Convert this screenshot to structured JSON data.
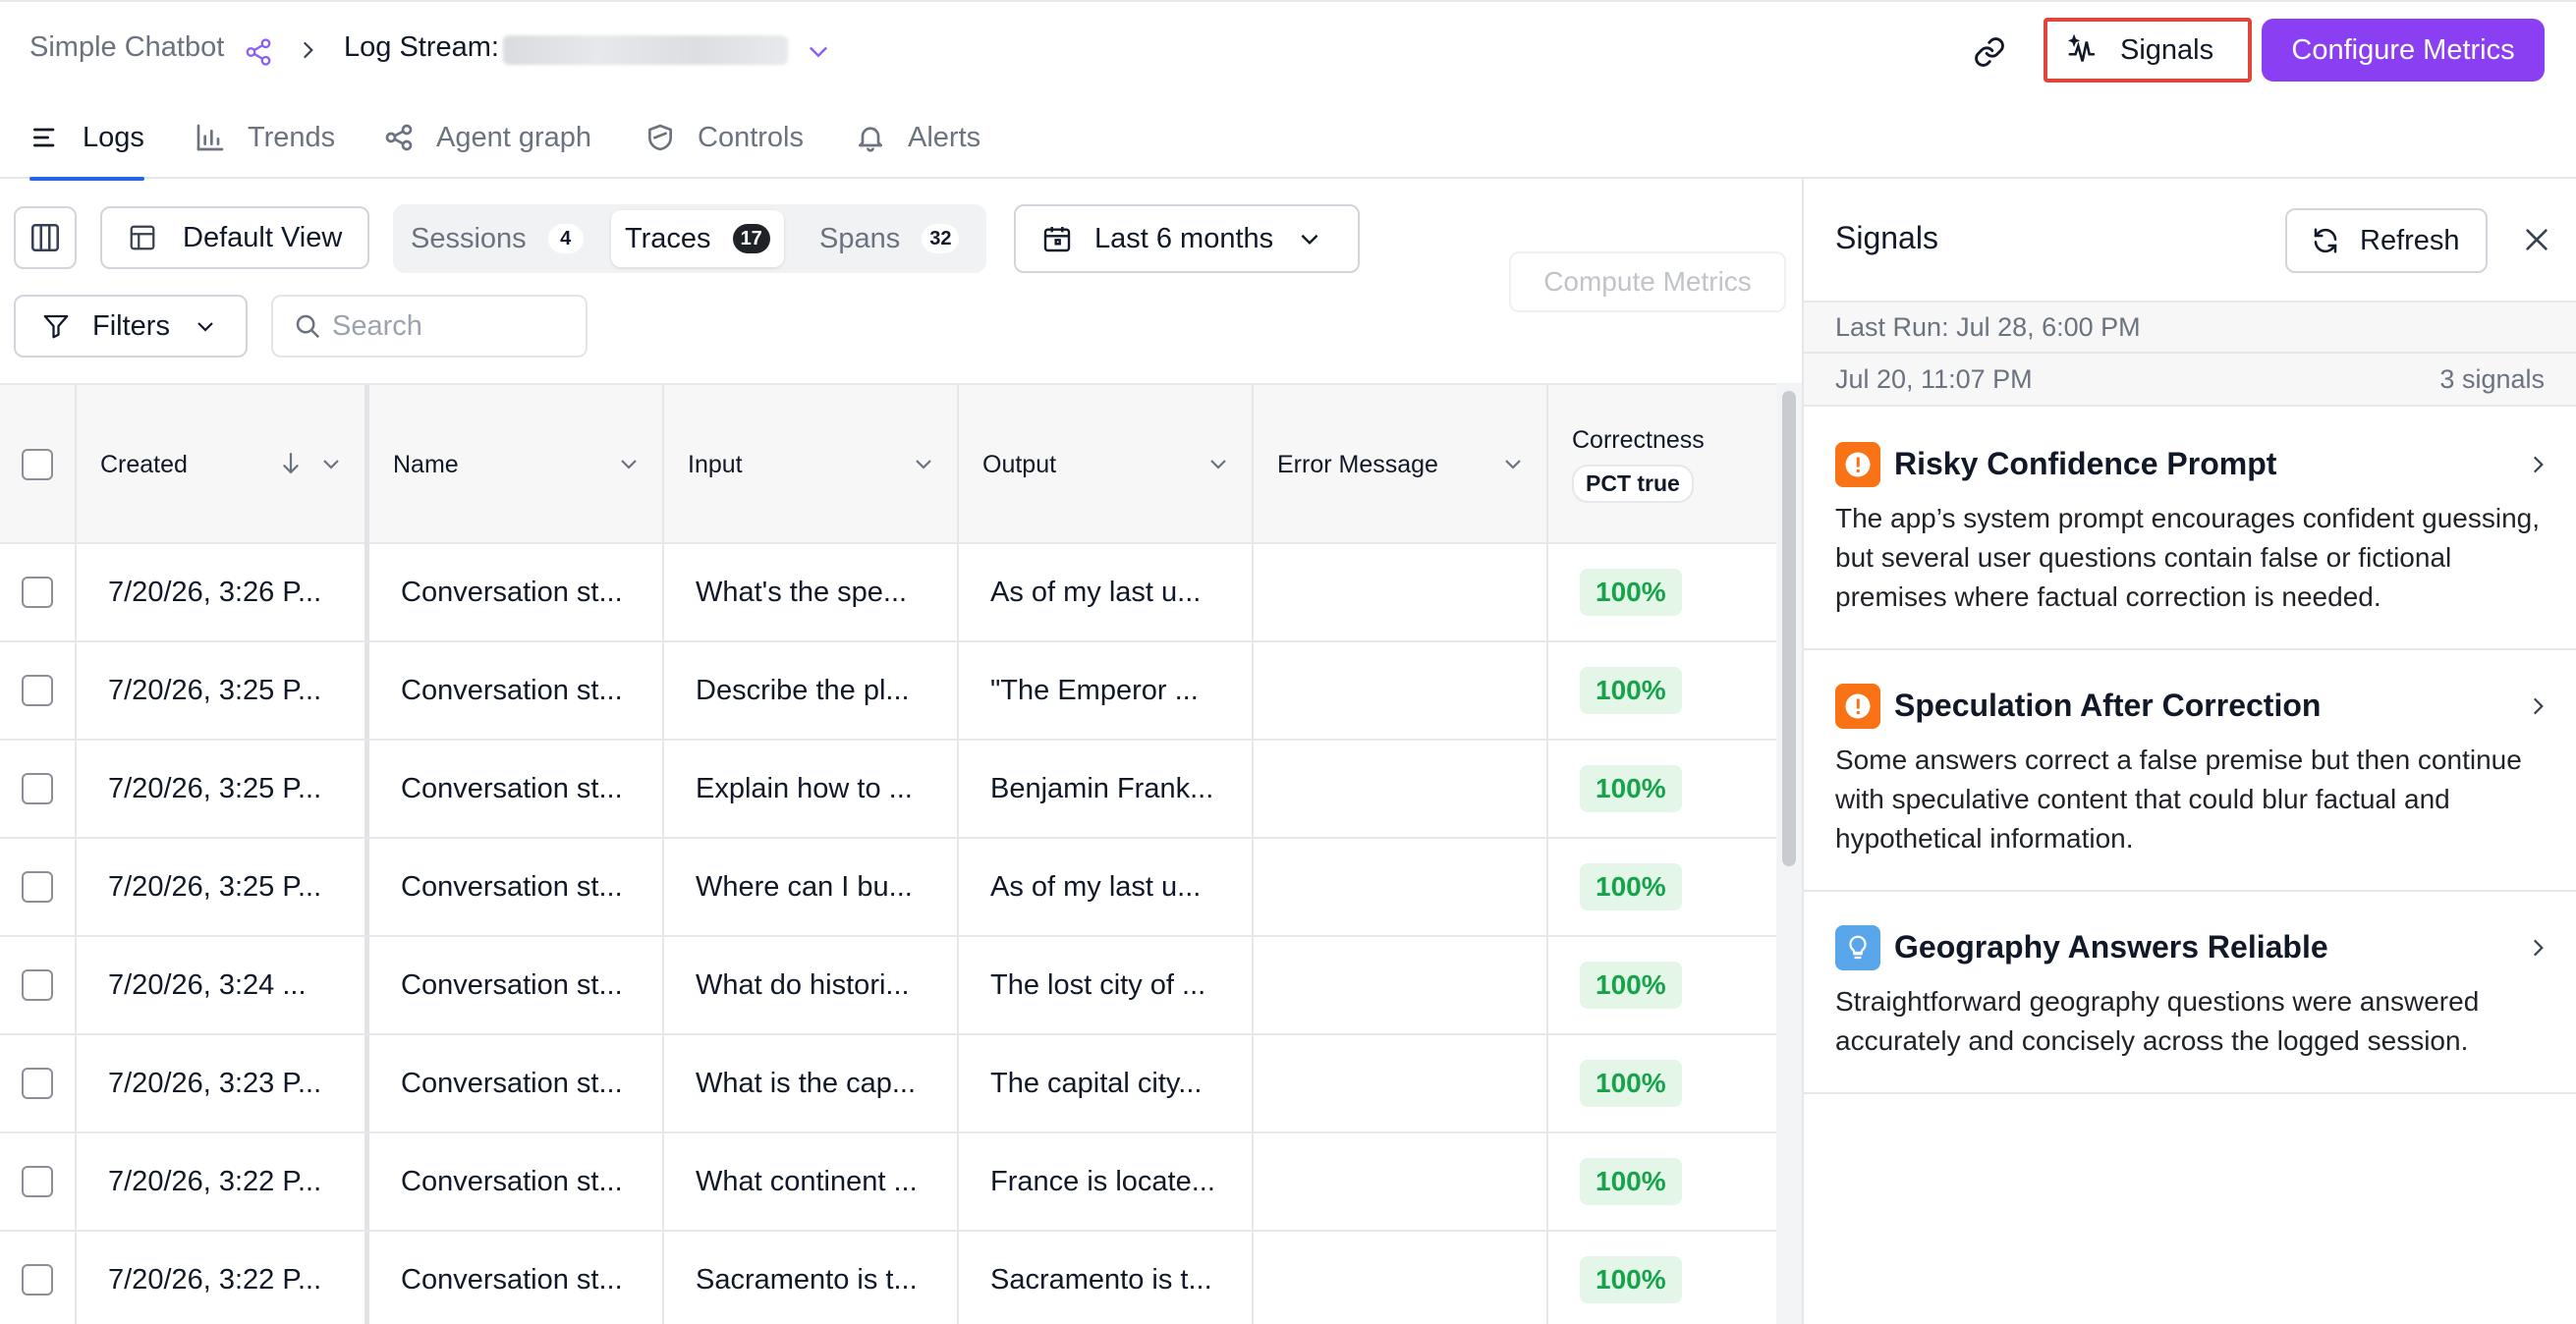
{
  "breadcrumb": {
    "app": "Simple Chatbot",
    "log_stream_label": "Log Stream:"
  },
  "header": {
    "signals_label": "Signals",
    "configure_label": "Configure Metrics"
  },
  "nav_tabs": [
    {
      "label": "Logs",
      "icon": "list-icon",
      "active": true
    },
    {
      "label": "Trends",
      "icon": "bar-chart-icon",
      "active": false
    },
    {
      "label": "Agent graph",
      "icon": "graph-icon",
      "active": false
    },
    {
      "label": "Controls",
      "icon": "shield-icon",
      "active": false
    },
    {
      "label": "Alerts",
      "icon": "bell-icon",
      "active": false
    }
  ],
  "toolbar": {
    "view_label": "Default View",
    "segments": [
      {
        "label": "Sessions",
        "count": "4"
      },
      {
        "label": "Traces",
        "count": "17"
      },
      {
        "label": "Spans",
        "count": "32"
      }
    ],
    "date_range": "Last 6 months",
    "compute_label": "Compute Metrics",
    "filters_label": "Filters",
    "search_placeholder": "Search"
  },
  "table": {
    "columns": {
      "created": "Created",
      "name": "Name",
      "input": "Input",
      "output": "Output",
      "error": "Error Message",
      "correctness": "Correctness",
      "correctness_pill": "PCT true"
    },
    "rows": [
      {
        "created": "7/20/26, 3:26 P...",
        "name": "Conversation st...",
        "input": "What's the spe...",
        "output": "As of my last u...",
        "error": "",
        "correctness": "100%"
      },
      {
        "created": "7/20/26, 3:25 P...",
        "name": "Conversation st...",
        "input": "Describe the pl...",
        "output": "\"The Emperor ...",
        "error": "",
        "correctness": "100%"
      },
      {
        "created": "7/20/26, 3:25 P...",
        "name": "Conversation st...",
        "input": "Explain how to ...",
        "output": "Benjamin Frank...",
        "error": "",
        "correctness": "100%"
      },
      {
        "created": "7/20/26, 3:25 P...",
        "name": "Conversation st...",
        "input": "Where can I bu...",
        "output": "As of my last u...",
        "error": "",
        "correctness": "100%"
      },
      {
        "created": "7/20/26, 3:24 ...",
        "name": "Conversation st...",
        "input": "What do histori...",
        "output": "The lost city of ...",
        "error": "",
        "correctness": "100%"
      },
      {
        "created": "7/20/26, 3:23 P...",
        "name": "Conversation st...",
        "input": "What is the cap...",
        "output": "The capital city...",
        "error": "",
        "correctness": "100%"
      },
      {
        "created": "7/20/26, 3:22 P...",
        "name": "Conversation st...",
        "input": "What continent ...",
        "output": "France is locate...",
        "error": "",
        "correctness": "100%"
      },
      {
        "created": "7/20/26, 3:22 P...",
        "name": "Conversation st...",
        "input": "Sacramento is t...",
        "output": "Sacramento is t...",
        "error": "",
        "correctness": "100%"
      }
    ]
  },
  "signals_panel": {
    "title": "Signals",
    "refresh_label": "Refresh",
    "last_run": "Last Run: Jul 28, 6:00 PM",
    "run_date": "Jul 20, 11:07 PM",
    "run_count": "3 signals",
    "items": [
      {
        "title": "Risky Confidence Prompt",
        "icon": "warning-icon",
        "color": "#f97316",
        "desc": "The app’s system prompt encourages confident guessing, but several user questions contain false or fictional premises where factual correction is needed."
      },
      {
        "title": "Speculation After Correction",
        "icon": "warning-icon",
        "color": "#f97316",
        "desc": "Some answers correct a false premise but then continue with speculative content that could blur factual and hypothetical information."
      },
      {
        "title": "Geography Answers Reliable",
        "icon": "lightbulb-icon",
        "color": "#5aa6ea",
        "desc": "Straightforward geography questions were answered accurately and concisely across the logged session."
      }
    ]
  },
  "colors": {
    "accent": "#8b3ff2",
    "active_tab": "#2563eb",
    "success": "#16a34a",
    "highlight_border": "#e0453a"
  }
}
